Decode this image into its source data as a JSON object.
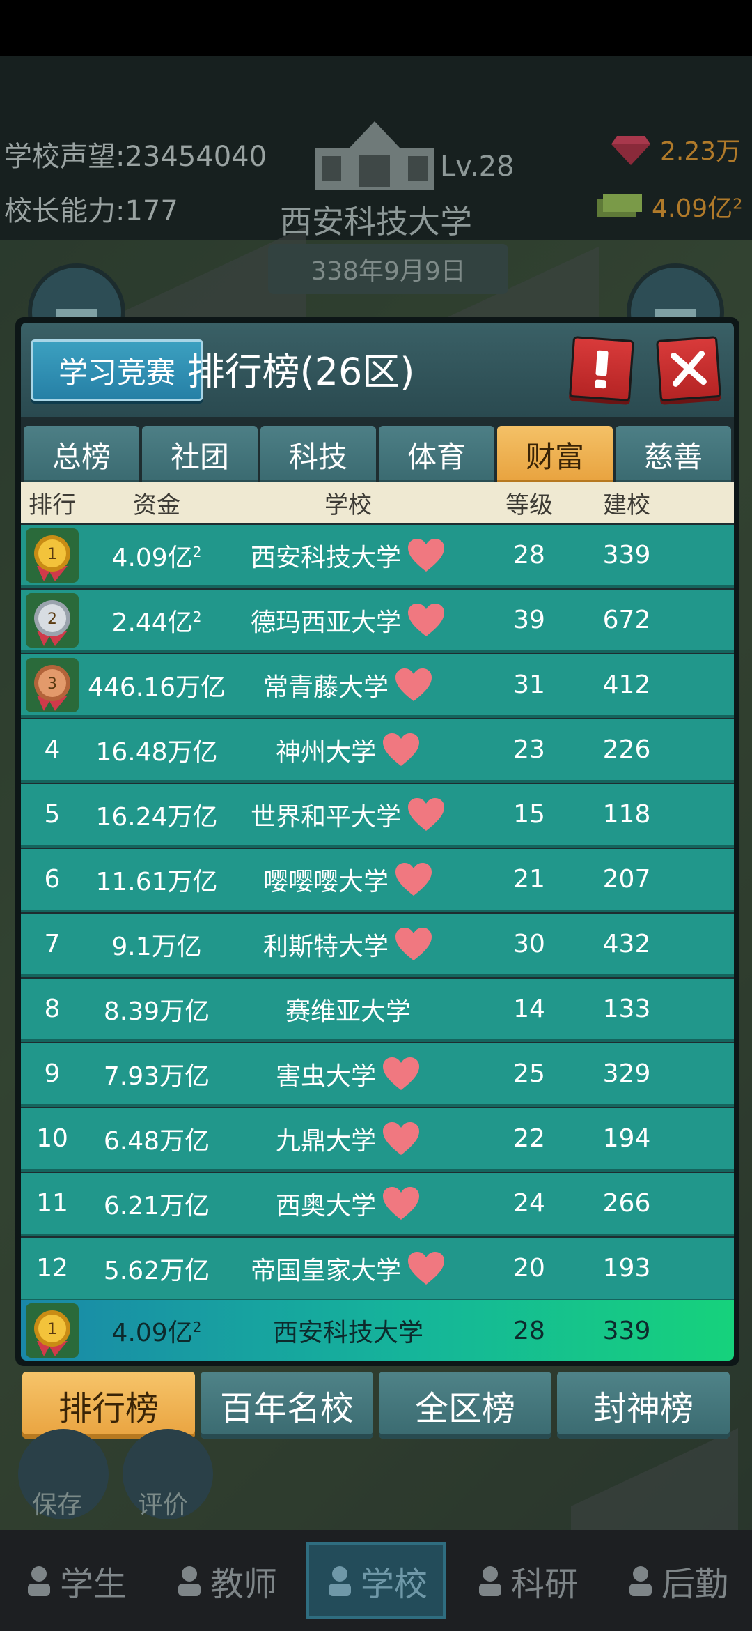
{
  "header": {
    "reputation_label": "学校声望:",
    "reputation_value": "23454040",
    "ability_label": "校长能力:",
    "ability_value": "177",
    "school_name": "西安科技大学",
    "level": "Lv.28",
    "gems": "2.23万",
    "cash": "4.09亿²",
    "date": "338年9月9日"
  },
  "panel": {
    "study_button": "学习竞赛",
    "title": "排行榜(26区)",
    "tabs": [
      {
        "label": "总榜",
        "active": false
      },
      {
        "label": "社团",
        "active": false
      },
      {
        "label": "科技",
        "active": false
      },
      {
        "label": "体育",
        "active": false
      },
      {
        "label": "财富",
        "active": true
      },
      {
        "label": "慈善",
        "active": false
      }
    ],
    "columns": [
      "排行",
      "资金",
      "学校",
      "等级",
      "建校"
    ],
    "rows": [
      {
        "rank": "1",
        "medal": "gold",
        "fund": "4.09亿",
        "fund_sup": "2",
        "school": "西安科技大学",
        "heart": true,
        "level": "28",
        "year": "339"
      },
      {
        "rank": "2",
        "medal": "silver",
        "fund": "2.44亿",
        "fund_sup": "2",
        "school": "德玛西亚大学",
        "heart": true,
        "level": "39",
        "year": "672"
      },
      {
        "rank": "3",
        "medal": "bronze",
        "fund": "446.16万亿",
        "fund_sup": "",
        "school": "常青藤大学",
        "heart": true,
        "level": "31",
        "year": "412"
      },
      {
        "rank": "4",
        "medal": "",
        "fund": "16.48万亿",
        "fund_sup": "",
        "school": "神州大学",
        "heart": true,
        "level": "23",
        "year": "226"
      },
      {
        "rank": "5",
        "medal": "",
        "fund": "16.24万亿",
        "fund_sup": "",
        "school": "世界和平大学",
        "heart": true,
        "level": "15",
        "year": "118"
      },
      {
        "rank": "6",
        "medal": "",
        "fund": "11.61万亿",
        "fund_sup": "",
        "school": "嘤嘤嘤大学",
        "heart": true,
        "level": "21",
        "year": "207"
      },
      {
        "rank": "7",
        "medal": "",
        "fund": "9.1万亿",
        "fund_sup": "",
        "school": "利斯特大学",
        "heart": true,
        "level": "30",
        "year": "432"
      },
      {
        "rank": "8",
        "medal": "",
        "fund": "8.39万亿",
        "fund_sup": "",
        "school": "赛维亚大学",
        "heart": false,
        "level": "14",
        "year": "133"
      },
      {
        "rank": "9",
        "medal": "",
        "fund": "7.93万亿",
        "fund_sup": "",
        "school": "害虫大学",
        "heart": true,
        "level": "25",
        "year": "329"
      },
      {
        "rank": "10",
        "medal": "",
        "fund": "6.48万亿",
        "fund_sup": "",
        "school": "九鼎大学",
        "heart": true,
        "level": "22",
        "year": "194"
      },
      {
        "rank": "11",
        "medal": "",
        "fund": "6.21万亿",
        "fund_sup": "",
        "school": "西奥大学",
        "heart": true,
        "level": "24",
        "year": "266"
      },
      {
        "rank": "12",
        "medal": "",
        "fund": "5.62万亿",
        "fund_sup": "",
        "school": "帝国皇家大学",
        "heart": true,
        "level": "20",
        "year": "193"
      }
    ],
    "self_row": {
      "rank": "1",
      "medal": "gold",
      "fund": "4.09亿",
      "fund_sup": "2",
      "school": "西安科技大学",
      "level": "28",
      "year": "339"
    }
  },
  "bottom_tabs": [
    {
      "label": "排行榜",
      "active": true
    },
    {
      "label": "百年名校",
      "active": false
    },
    {
      "label": "全区榜",
      "active": false
    },
    {
      "label": "封神榜",
      "active": false
    }
  ],
  "utilities": {
    "save": "保存",
    "review": "评价"
  },
  "navbar": [
    {
      "label": "学生",
      "icon": "student-icon",
      "active": false
    },
    {
      "label": "教师",
      "icon": "teacher-icon",
      "active": false
    },
    {
      "label": "学校",
      "icon": "school-icon",
      "active": true
    },
    {
      "label": "科研",
      "icon": "flask-icon",
      "active": false
    },
    {
      "label": "后勤",
      "icon": "clipboard-icon",
      "active": false
    }
  ],
  "colors": {
    "row": "#21978b",
    "accent_tab": "#e8a23e",
    "close_button": "#d83a3a",
    "heart": "#f07880"
  }
}
